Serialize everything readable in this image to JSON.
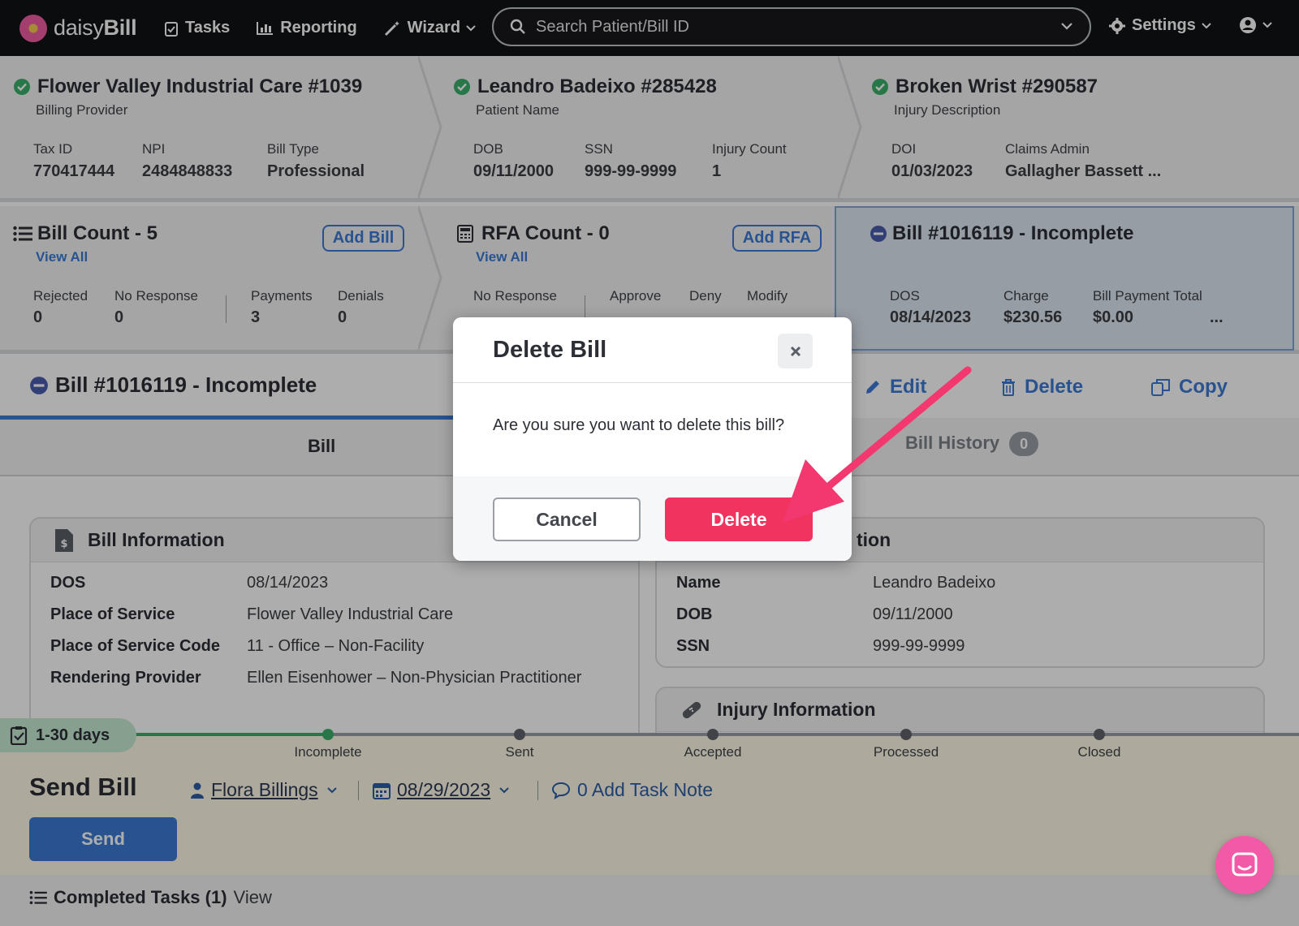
{
  "app": {
    "logo_plain": "daisy",
    "logo_bold": "Bill"
  },
  "nav": {
    "tasks": "Tasks",
    "reporting": "Reporting",
    "wizard": "Wizard",
    "search_placeholder": "Search Patient/Bill ID",
    "settings": "Settings"
  },
  "provider": {
    "title": "Flower Valley Industrial Care #1039",
    "subtitle": "Billing Provider",
    "tax_id_label": "Tax ID",
    "tax_id": "770417444",
    "npi_label": "NPI",
    "npi": "2484848833",
    "bill_type_label": "Bill Type",
    "bill_type": "Professional"
  },
  "patient": {
    "title": "Leandro Badeixo #285428",
    "subtitle": "Patient Name",
    "dob_label": "DOB",
    "dob": "09/11/2000",
    "ssn_label": "SSN",
    "ssn": "999-99-9999",
    "injury_count_label": "Injury Count",
    "injury_count": "1"
  },
  "injury": {
    "title": "Broken Wrist #290587",
    "subtitle": "Injury Description",
    "doi_label": "DOI",
    "doi": "01/03/2023",
    "claims_admin_label": "Claims Admin",
    "claims_admin": "Gallagher Bassett ..."
  },
  "bill_count": {
    "title": "Bill Count - 5",
    "add_label": "Add Bill",
    "view_all": "View All",
    "rejected_label": "Rejected",
    "rejected": "0",
    "no_response_label": "No Response",
    "no_response": "0",
    "payments_label": "Payments",
    "payments": "3",
    "denials_label": "Denials",
    "denials": "0"
  },
  "rfa_count": {
    "title": "RFA Count - 0",
    "add_label": "Add RFA",
    "view_all": "View All",
    "no_response_label": "No Response",
    "approve_label": "Approve",
    "deny_label": "Deny",
    "modify_label": "Modify"
  },
  "current_bill": {
    "title": "Bill #1016119 - Incomplete",
    "dos_label": "DOS",
    "dos": "08/14/2023",
    "charge_label": "Charge",
    "charge": "$230.56",
    "payment_total_label": "Bill Payment Total",
    "payment_total": "$0.00",
    "more": "..."
  },
  "bill_header": {
    "title": "Bill #1016119 - Incomplete",
    "edit": "Edit",
    "delete": "Delete",
    "copy": "Copy"
  },
  "tabs": {
    "bill": "Bill",
    "history": "Bill History",
    "history_count": "0"
  },
  "bill_info": {
    "heading": "Bill Information",
    "rows": [
      {
        "key": "DOS",
        "value": "08/14/2023"
      },
      {
        "key": "Place of Service",
        "value": "Flower Valley Industrial Care"
      },
      {
        "key": "Place of Service Code",
        "value": "11 - Office – Non-Facility"
      },
      {
        "key": "Rendering Provider",
        "value": "Ellen Eisenhower – Non-Physician Practitioner"
      }
    ]
  },
  "patient_info": {
    "heading_visible": "tion",
    "rows": [
      {
        "key": "Name",
        "value": "Leandro Badeixo"
      },
      {
        "key": "DOB",
        "value": "09/11/2000"
      },
      {
        "key": "SSN",
        "value": "999-99-9999"
      }
    ]
  },
  "injury_info": {
    "heading": "Injury Information"
  },
  "task": {
    "days": "1-30 days",
    "stages": [
      "Incomplete",
      "Sent",
      "Accepted",
      "Processed",
      "Closed"
    ],
    "completed_stages": 1,
    "title": "Send Bill",
    "assignee": "Flora Billings",
    "due_date": "08/29/2023",
    "notes": "0 Add Task Note",
    "send_label": "Send",
    "completed_prefix": "Completed Tasks (1)",
    "completed_view": "View"
  },
  "modal": {
    "title": "Delete Bill",
    "message": "Are you sure you want to delete this bill?",
    "cancel": "Cancel",
    "confirm": "Delete"
  },
  "colors": {
    "brand_blue": "#3b7bd4",
    "danger": "#f0345f",
    "success": "#3bb06b",
    "annotation_arrow": "#f2386e"
  }
}
